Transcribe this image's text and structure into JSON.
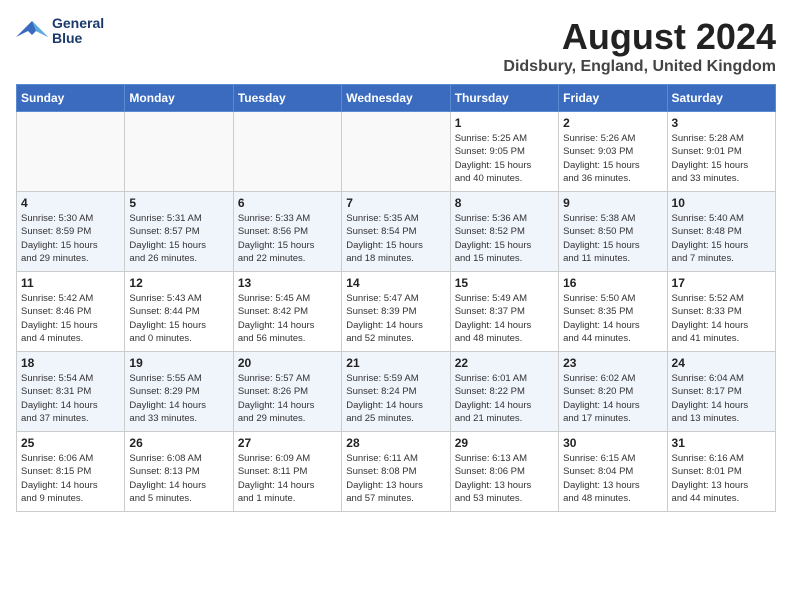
{
  "header": {
    "logo_line1": "General",
    "logo_line2": "Blue",
    "month": "August 2024",
    "location": "Didsbury, England, United Kingdom"
  },
  "days_of_week": [
    "Sunday",
    "Monday",
    "Tuesday",
    "Wednesday",
    "Thursday",
    "Friday",
    "Saturday"
  ],
  "weeks": [
    [
      {
        "day": "",
        "info": ""
      },
      {
        "day": "",
        "info": ""
      },
      {
        "day": "",
        "info": ""
      },
      {
        "day": "",
        "info": ""
      },
      {
        "day": "1",
        "info": "Sunrise: 5:25 AM\nSunset: 9:05 PM\nDaylight: 15 hours\nand 40 minutes."
      },
      {
        "day": "2",
        "info": "Sunrise: 5:26 AM\nSunset: 9:03 PM\nDaylight: 15 hours\nand 36 minutes."
      },
      {
        "day": "3",
        "info": "Sunrise: 5:28 AM\nSunset: 9:01 PM\nDaylight: 15 hours\nand 33 minutes."
      }
    ],
    [
      {
        "day": "4",
        "info": "Sunrise: 5:30 AM\nSunset: 8:59 PM\nDaylight: 15 hours\nand 29 minutes."
      },
      {
        "day": "5",
        "info": "Sunrise: 5:31 AM\nSunset: 8:57 PM\nDaylight: 15 hours\nand 26 minutes."
      },
      {
        "day": "6",
        "info": "Sunrise: 5:33 AM\nSunset: 8:56 PM\nDaylight: 15 hours\nand 22 minutes."
      },
      {
        "day": "7",
        "info": "Sunrise: 5:35 AM\nSunset: 8:54 PM\nDaylight: 15 hours\nand 18 minutes."
      },
      {
        "day": "8",
        "info": "Sunrise: 5:36 AM\nSunset: 8:52 PM\nDaylight: 15 hours\nand 15 minutes."
      },
      {
        "day": "9",
        "info": "Sunrise: 5:38 AM\nSunset: 8:50 PM\nDaylight: 15 hours\nand 11 minutes."
      },
      {
        "day": "10",
        "info": "Sunrise: 5:40 AM\nSunset: 8:48 PM\nDaylight: 15 hours\nand 7 minutes."
      }
    ],
    [
      {
        "day": "11",
        "info": "Sunrise: 5:42 AM\nSunset: 8:46 PM\nDaylight: 15 hours\nand 4 minutes."
      },
      {
        "day": "12",
        "info": "Sunrise: 5:43 AM\nSunset: 8:44 PM\nDaylight: 15 hours\nand 0 minutes."
      },
      {
        "day": "13",
        "info": "Sunrise: 5:45 AM\nSunset: 8:42 PM\nDaylight: 14 hours\nand 56 minutes."
      },
      {
        "day": "14",
        "info": "Sunrise: 5:47 AM\nSunset: 8:39 PM\nDaylight: 14 hours\nand 52 minutes."
      },
      {
        "day": "15",
        "info": "Sunrise: 5:49 AM\nSunset: 8:37 PM\nDaylight: 14 hours\nand 48 minutes."
      },
      {
        "day": "16",
        "info": "Sunrise: 5:50 AM\nSunset: 8:35 PM\nDaylight: 14 hours\nand 44 minutes."
      },
      {
        "day": "17",
        "info": "Sunrise: 5:52 AM\nSunset: 8:33 PM\nDaylight: 14 hours\nand 41 minutes."
      }
    ],
    [
      {
        "day": "18",
        "info": "Sunrise: 5:54 AM\nSunset: 8:31 PM\nDaylight: 14 hours\nand 37 minutes."
      },
      {
        "day": "19",
        "info": "Sunrise: 5:55 AM\nSunset: 8:29 PM\nDaylight: 14 hours\nand 33 minutes."
      },
      {
        "day": "20",
        "info": "Sunrise: 5:57 AM\nSunset: 8:26 PM\nDaylight: 14 hours\nand 29 minutes."
      },
      {
        "day": "21",
        "info": "Sunrise: 5:59 AM\nSunset: 8:24 PM\nDaylight: 14 hours\nand 25 minutes."
      },
      {
        "day": "22",
        "info": "Sunrise: 6:01 AM\nSunset: 8:22 PM\nDaylight: 14 hours\nand 21 minutes."
      },
      {
        "day": "23",
        "info": "Sunrise: 6:02 AM\nSunset: 8:20 PM\nDaylight: 14 hours\nand 17 minutes."
      },
      {
        "day": "24",
        "info": "Sunrise: 6:04 AM\nSunset: 8:17 PM\nDaylight: 14 hours\nand 13 minutes."
      }
    ],
    [
      {
        "day": "25",
        "info": "Sunrise: 6:06 AM\nSunset: 8:15 PM\nDaylight: 14 hours\nand 9 minutes."
      },
      {
        "day": "26",
        "info": "Sunrise: 6:08 AM\nSunset: 8:13 PM\nDaylight: 14 hours\nand 5 minutes."
      },
      {
        "day": "27",
        "info": "Sunrise: 6:09 AM\nSunset: 8:11 PM\nDaylight: 14 hours\nand 1 minute."
      },
      {
        "day": "28",
        "info": "Sunrise: 6:11 AM\nSunset: 8:08 PM\nDaylight: 13 hours\nand 57 minutes."
      },
      {
        "day": "29",
        "info": "Sunrise: 6:13 AM\nSunset: 8:06 PM\nDaylight: 13 hours\nand 53 minutes."
      },
      {
        "day": "30",
        "info": "Sunrise: 6:15 AM\nSunset: 8:04 PM\nDaylight: 13 hours\nand 48 minutes."
      },
      {
        "day": "31",
        "info": "Sunrise: 6:16 AM\nSunset: 8:01 PM\nDaylight: 13 hours\nand 44 minutes."
      }
    ]
  ]
}
